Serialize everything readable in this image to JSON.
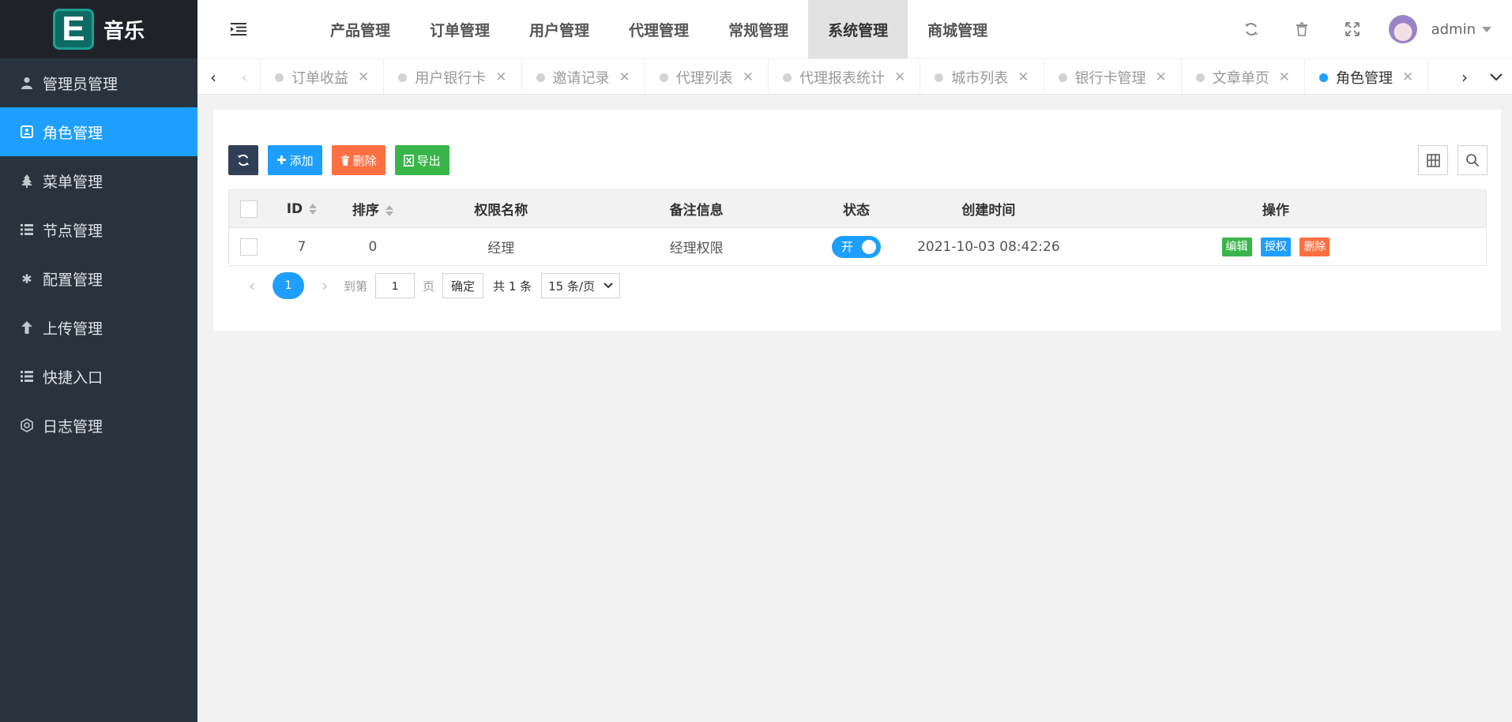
{
  "app": {
    "logo_letter": "E",
    "title": "音乐"
  },
  "sidebar": {
    "items": [
      {
        "label": "管理员管理",
        "icon": "user-icon"
      },
      {
        "label": "角色管理",
        "icon": "role-icon"
      },
      {
        "label": "菜单管理",
        "icon": "tree-icon"
      },
      {
        "label": "节点管理",
        "icon": "list-icon"
      },
      {
        "label": "配置管理",
        "icon": "asterisk-icon"
      },
      {
        "label": "上传管理",
        "icon": "arrow-up-icon"
      },
      {
        "label": "快捷入口",
        "icon": "list-icon"
      },
      {
        "label": "日志管理",
        "icon": "log-icon"
      }
    ]
  },
  "header": {
    "menu": [
      "产品管理",
      "订单管理",
      "用户管理",
      "代理管理",
      "常规管理",
      "系统管理",
      "商城管理"
    ],
    "active_menu": "系统管理",
    "username": "admin"
  },
  "tabs": {
    "items": [
      "订单收益",
      "用户银行卡",
      "邀请记录",
      "代理列表",
      "代理报表统计",
      "城市列表",
      "银行卡管理",
      "文章单页",
      "角色管理"
    ],
    "active": "角色管理"
  },
  "toolbar": {
    "add_label": "添加",
    "delete_label": "删除",
    "export_label": "导出"
  },
  "table": {
    "columns": [
      "ID",
      "排序",
      "权限名称",
      "备注信息",
      "状态",
      "创建时间",
      "操作"
    ],
    "rows": [
      {
        "id": "7",
        "sort": "0",
        "name": "经理",
        "remark": "经理权限",
        "status": "开",
        "created": "2021-10-03 08:42:26"
      }
    ],
    "actions": {
      "edit": "编辑",
      "auth": "授权",
      "delete": "删除"
    }
  },
  "pager": {
    "current_page": "1",
    "goto_label": "到第",
    "goto_value": "1",
    "page_unit": "页",
    "confirm": "确定",
    "total": "共 1 条",
    "page_size": "15 条/页"
  },
  "colors": {
    "sidebar_bg": "#28333e",
    "accent": "#1e9fff",
    "success": "#3ab54a",
    "danger": "#ff5722"
  }
}
